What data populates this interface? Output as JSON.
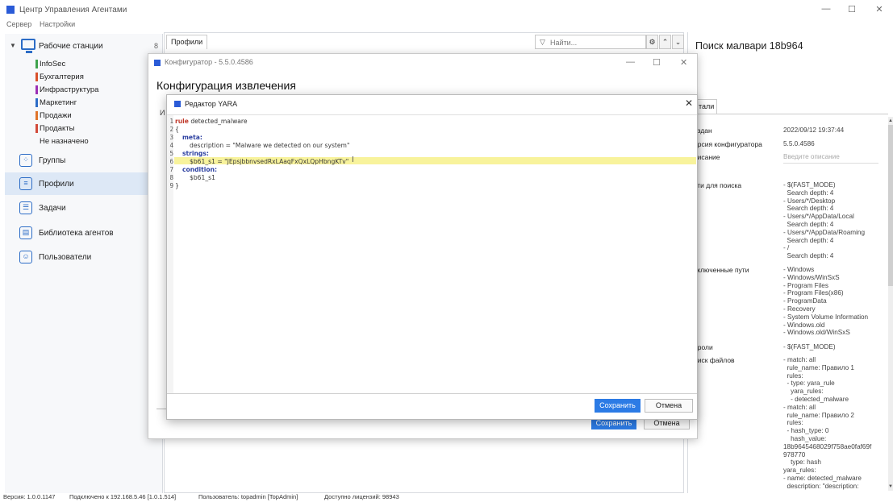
{
  "app": {
    "title": "Центр Управления Агентами"
  },
  "menu": {
    "items": [
      "Сервер",
      "Настройки"
    ]
  },
  "sidebar": {
    "workstations": {
      "label": "Рабочие станции",
      "count": "8"
    },
    "groups": [
      {
        "label": "InfoSec",
        "color": "#3fa34d"
      },
      {
        "label": "Бухгалтерия",
        "color": "#d9502a"
      },
      {
        "label": "Инфраструктура",
        "color": "#9b2fb5"
      },
      {
        "label": "Маркетинг",
        "color": "#2c6cc6"
      },
      {
        "label": "Продажи",
        "color": "#e0742a"
      },
      {
        "label": "Продакты",
        "color": "#d24a3a"
      },
      {
        "label": "Не назначено",
        "color": ""
      }
    ],
    "nav": [
      {
        "label": "Группы",
        "icon": "groups-icon"
      },
      {
        "label": "Профили",
        "icon": "profiles-icon"
      },
      {
        "label": "Задачи",
        "icon": "tasks-icon"
      },
      {
        "label": "Библиотека агентов",
        "icon": "agent-library-icon"
      },
      {
        "label": "Пользователи",
        "icon": "users-icon"
      }
    ]
  },
  "center": {
    "tab": "Профили",
    "search_placeholder": "Найти..."
  },
  "right": {
    "title": "Поиск малвари 18b964",
    "tab": "тали",
    "props": [
      {
        "label": "оздан",
        "value": "2022/09/12 19:37:44"
      },
      {
        "label": "ерсия конфигуратора",
        "value": "5.5.0.4586"
      },
      {
        "label": "писание",
        "value": "Введите описание"
      },
      {
        "label": "ути для поиска",
        "value": "- $(FAST_MODE)\n  Search depth: 4\n- Users/*/Desktop\n  Search depth: 4\n- Users/*/AppData/Local\n  Search depth: 4\n- Users/*/AppData/Roaming\n  Search depth: 4\n- /\n  Search depth: 4"
      },
      {
        "label": "сключенные пути",
        "value": "- Windows\n- Windows/WinSxS\n- Program Files\n- Program Files(x86)\n- ProgramData\n- Recovery\n- System Volume Information\n- Windows.old\n- Windows.old/WinSxS"
      },
      {
        "label": "ароли",
        "value": "- $(FAST_MODE)"
      },
      {
        "label": "оиск файлов",
        "value": "- match: all\n  rule_name: Правило 1\n  rules:\n  - type: yara_rule\n    yara_rules:\n    - detected_malware\n- match: all\n  rule_name: Правило 2\n  rules:\n  - hash_type: 0\n    hash_value:\n18b9645468029f758ae0faf69f\n978770\n    type: hash\nyara_rules:\n- name: detected_malware\n  description: \"description:"
      }
    ]
  },
  "status": {
    "version": "Версия: 1.0.0.1147",
    "connection": "Подключено к 192.168.5.46 [1.0.1.514]",
    "user": "Пользователь: topadmin [TopAdmin]",
    "licenses": "Доступно лицензий: 98943"
  },
  "configurator": {
    "title": "Конфигуратор - 5.5.0.4586",
    "heading": "Конфигурация извлечения",
    "stub": "И",
    "save": "Сохранить",
    "cancel": "Отмена"
  },
  "yara": {
    "title": "Редактор YARA",
    "line_numbers": [
      "1",
      "2",
      "3",
      "4",
      "5",
      "6",
      "7",
      "8",
      "9"
    ],
    "code": {
      "l1_kw": "rule",
      "l1_name": " detected_malware",
      "l2": "{",
      "l3": "meta:",
      "l4": "description = \"Malware we detected on our system\"",
      "l5": "strings:",
      "l6": "$b61_s1 = \"JEpsjbbnvsedRxLAaqFxQxLQpHbngKTv\"",
      "l7": "condition:",
      "l8": "$b61_s1",
      "l9": "}"
    },
    "save": "Сохранить",
    "cancel": "Отмена"
  }
}
